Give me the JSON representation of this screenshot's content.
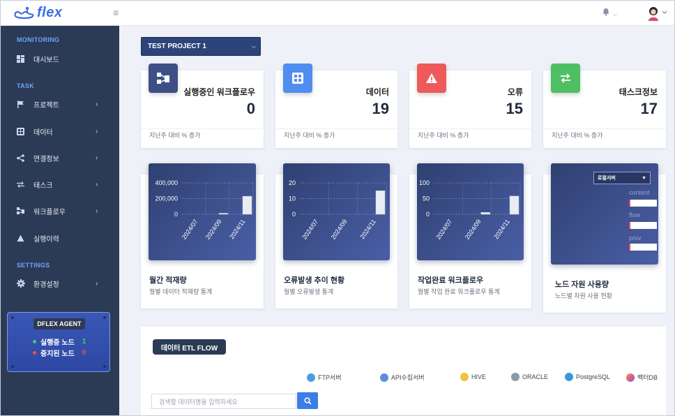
{
  "app": {
    "logo_text": "flex"
  },
  "sidebar": {
    "sections": {
      "monitoring": "MONITORING",
      "task": "TASK",
      "settings": "SETTINGS"
    },
    "items": [
      {
        "label": "대시보드",
        "icon": "dashboard-icon"
      },
      {
        "label": "프로젝트",
        "icon": "flag-icon"
      },
      {
        "label": "데이터",
        "icon": "grid-icon"
      },
      {
        "label": "연결정보",
        "icon": "share-icon"
      },
      {
        "label": "태스크",
        "icon": "transfer-icon"
      },
      {
        "label": "워크플로우",
        "icon": "workflow-icon"
      },
      {
        "label": "실행이력",
        "icon": "triangle-icon"
      },
      {
        "label": "환경설정",
        "icon": "gear-icon"
      }
    ],
    "agent": {
      "title": "DFLEX AGENT",
      "running_label": "실행중 노드",
      "running_value": "1",
      "stopped_label": "중지된 노드",
      "stopped_value": "0"
    }
  },
  "project": {
    "selected": "TEST PROJECT 1"
  },
  "stats": [
    {
      "title": "실행중인 워크플로우",
      "value": "0",
      "footer": "지난주 대비 % 증가",
      "color": "#3e4f86"
    },
    {
      "title": "데이터",
      "value": "19",
      "footer": "지난주 대비 % 증가",
      "color": "#4f8df0"
    },
    {
      "title": "오류",
      "value": "15",
      "footer": "지난주 대비 % 증가",
      "color": "#ee5a5a"
    },
    {
      "title": "태스크정보",
      "value": "17",
      "footer": "지난주 대비 % 증가",
      "color": "#4fbf63"
    }
  ],
  "charts": [
    {
      "title": "월간 적재량",
      "subtitle": "월별 데이터 적재량 통계"
    },
    {
      "title": "오류발생 추이 현황",
      "subtitle": "월별 오류발생 통계"
    },
    {
      "title": "작업완료 워크플로우",
      "subtitle": "월별 작업 완료 워크플로우 통계"
    },
    {
      "title": "노드 자원 사용량",
      "subtitle": "노드별 자원 사용 현황"
    }
  ],
  "chart_data": [
    {
      "type": "bar",
      "categories": [
        "2024/07",
        "2024/09",
        "2024/11"
      ],
      "values": [
        0,
        2000,
        230000
      ],
      "ylim": [
        0,
        400000
      ],
      "yticks": [
        "0",
        "200,000",
        "400,000"
      ]
    },
    {
      "type": "bar",
      "categories": [
        "2024/07",
        "2024/09",
        "2024/11"
      ],
      "values": [
        0,
        0,
        15
      ],
      "ylim": [
        0,
        20
      ],
      "yticks": [
        "0",
        "10",
        "20"
      ]
    },
    {
      "type": "bar",
      "categories": [
        "2024/07",
        "2024/09",
        "2024/11"
      ],
      "values": [
        0,
        6,
        58
      ],
      "ylim": [
        0,
        100
      ],
      "yticks": [
        "0",
        "50",
        "100"
      ]
    },
    {
      "type": "bar",
      "node_select": "로컬서버",
      "categories": [
        "content",
        "flow",
        "prov"
      ],
      "values": [
        0.03,
        0.03,
        0.03
      ]
    }
  ],
  "etl": {
    "title": "데이터 ETL FLOW",
    "legend": [
      {
        "label": "FTP서버",
        "color": "#4a9be8"
      },
      {
        "label": "API수집서버",
        "color": "#5a8fd8"
      },
      {
        "label": "HIVE",
        "color": "#f1c23a"
      },
      {
        "label": "ORACLE",
        "color": "#8b98a8"
      },
      {
        "label": "PostgreSQL",
        "color": "#3a9ad9"
      },
      {
        "label": "벡터DB",
        "color": "#e35a8b"
      }
    ],
    "search_placeholder": "검색할 데이터명을 입력하세요"
  }
}
